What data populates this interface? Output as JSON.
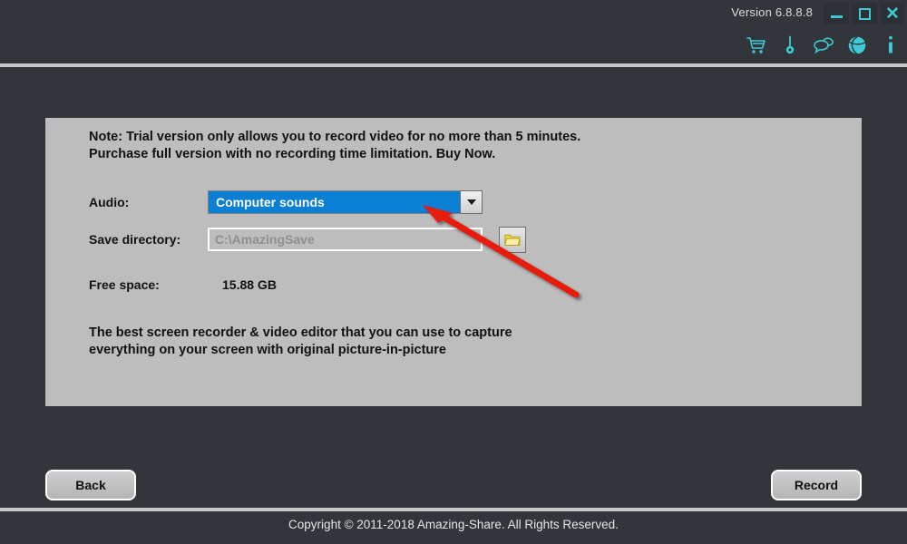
{
  "titlebar": {
    "version_label": "Version 6.8.8.8",
    "minimize_icon": "minimize-icon",
    "maximize_icon": "maximize-icon",
    "close_icon": "close-icon"
  },
  "toolbar": {
    "icons": [
      {
        "name": "shopping-cart-icon",
        "title": "Buy"
      },
      {
        "name": "key-icon",
        "title": "Register"
      },
      {
        "name": "chat-bubbles-icon",
        "title": "Feedback"
      },
      {
        "name": "globe-icon",
        "title": "Website"
      },
      {
        "name": "info-icon",
        "title": "About"
      }
    ]
  },
  "panel": {
    "note": "Note: Trial version only allows you to record video for no more than 5 minutes.\nPurchase full version with no recording time limitation. Buy Now.",
    "audio": {
      "label": "Audio:",
      "selected": "Computer sounds",
      "options": [
        "Computer sounds"
      ]
    },
    "save_directory": {
      "label": "Save directory:",
      "value": "C:\\AmazingSave",
      "placeholder": "C:\\AmazingSave",
      "browse_icon": "folder-icon"
    },
    "free_space": {
      "label": "Free space:",
      "value": "15.88 GB"
    },
    "tagline": "The best screen recorder & video editor that you can use to capture\neverything on your screen with original picture-in-picture"
  },
  "buttons": {
    "back_label": "Back",
    "record_label": "Record"
  },
  "footer": {
    "copyright": "Copyright © 2011-2018 Amazing-Share. All Rights Reserved."
  },
  "annotation": {
    "name": "red-arrow-annotation",
    "color": "#e81c0e",
    "points_to": "audio-dropdown"
  },
  "colors": {
    "window_bg": "#323539",
    "panel_bg": "#bdbdbd",
    "accent_teal": "#3fc9d4",
    "select_blue": "#0b7fd4",
    "divider": "#c8c8c8",
    "annotation_red": "#e81c0e"
  }
}
